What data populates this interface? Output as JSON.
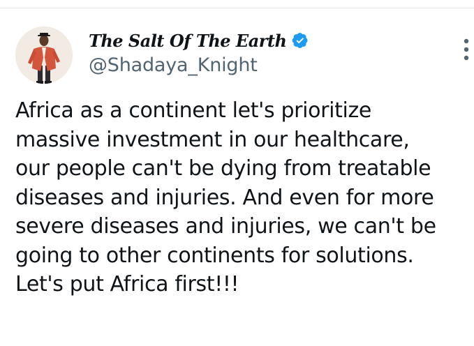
{
  "author": {
    "display_name": "The Salt Of The Earth",
    "handle": "@Shadaya_Knight",
    "verified": true,
    "verified_color": "#1d9bf0"
  },
  "tweet": {
    "lines": [
      "Africa as a continent let's prioritize",
      "massive investment in our healthcare,",
      "our people can't be dying from treatable",
      "diseases and injuries. And even for more",
      "severe diseases and injuries, we can't be",
      "going to other continents for solutions.",
      "Let's put Africa first!!!"
    ]
  },
  "icons": {
    "avatar": "profile-photo",
    "verified": "verified-badge-icon",
    "more": "more-options-icon"
  },
  "colors": {
    "text": "#0f1419",
    "secondary_text": "#536471",
    "divider": "#e6e9ec"
  }
}
